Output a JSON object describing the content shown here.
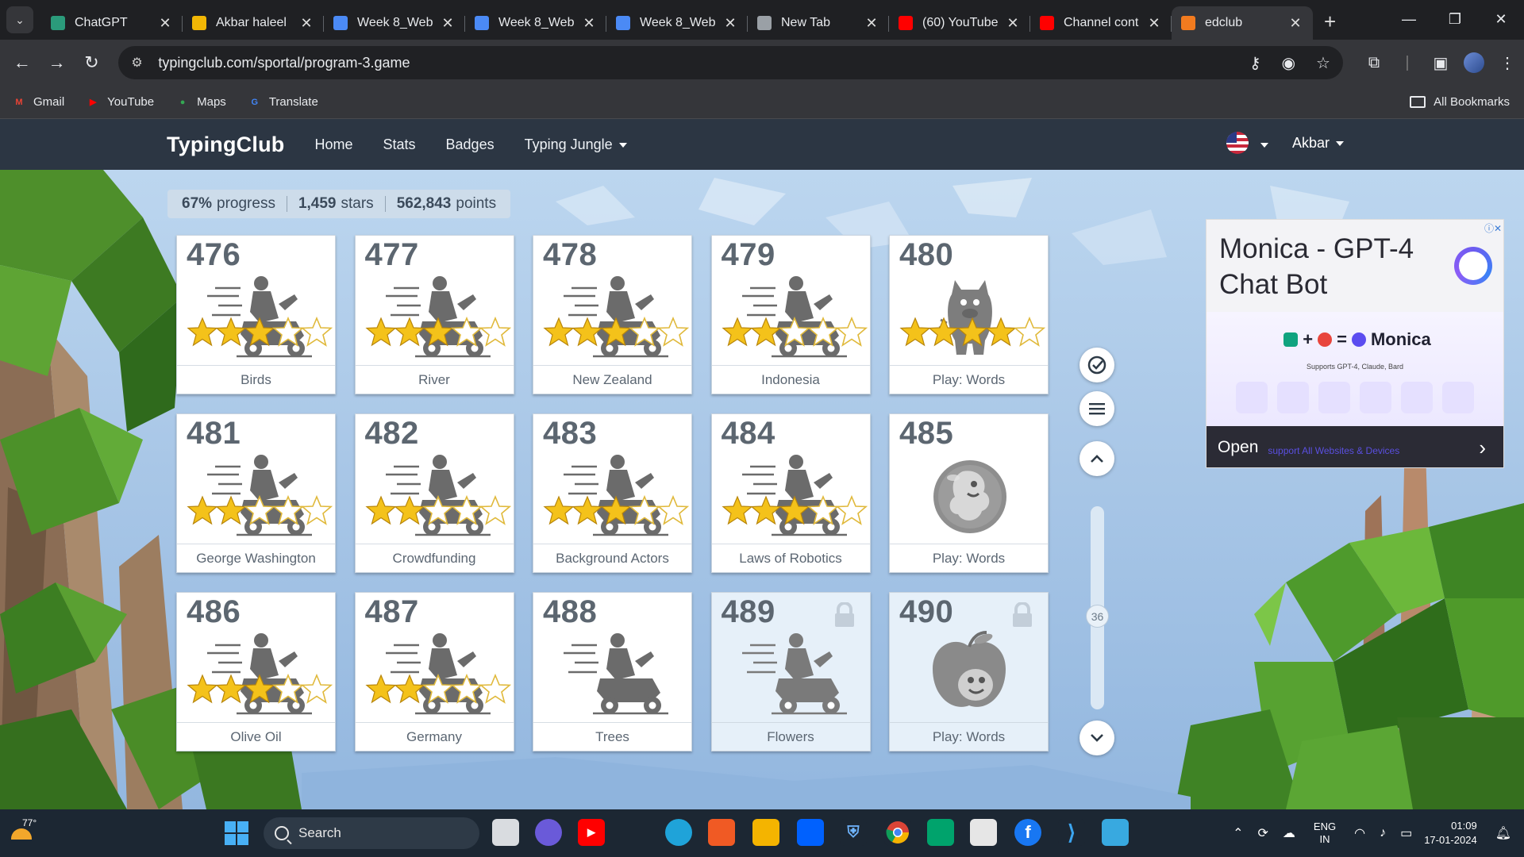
{
  "browser": {
    "tabs": [
      {
        "title": "ChatGPT",
        "favicon_color": "#2b9b7b"
      },
      {
        "title": "Akbar haleel",
        "favicon_color": "#f2b705"
      },
      {
        "title": "Week 8_Web",
        "favicon_color": "#4b8af5"
      },
      {
        "title": "Week 8_Web",
        "favicon_color": "#4b8af5"
      },
      {
        "title": "Week 8_Web",
        "favicon_color": "#4b8af5"
      },
      {
        "title": "New Tab",
        "favicon_color": "#9aa0a6"
      },
      {
        "title": "(60) YouTube",
        "favicon_color": "#ff0000"
      },
      {
        "title": "Channel cont",
        "favicon_color": "#ff0000"
      },
      {
        "title": "edclub",
        "favicon_color": "#f27b1f",
        "active": true
      }
    ],
    "url": "typingclub.com/sportal/program-3.game",
    "bookmarks": [
      {
        "label": "Gmail",
        "color": "#ea4335",
        "glyph": "M"
      },
      {
        "label": "YouTube",
        "color": "#ff0000",
        "glyph": "▶"
      },
      {
        "label": "Maps",
        "color": "#34a853",
        "glyph": "●"
      },
      {
        "label": "Translate",
        "color": "#4285f4",
        "glyph": "G"
      }
    ],
    "all_bookmarks_label": "All Bookmarks"
  },
  "site": {
    "brand": "TypingClub",
    "nav": [
      "Home",
      "Stats",
      "Badges",
      "Typing Jungle"
    ],
    "user": "Akbar"
  },
  "progress": {
    "percent": "67%",
    "percent_label": "progress",
    "stars": "1,459",
    "stars_label": "stars",
    "points": "562,843",
    "points_label": "points"
  },
  "lessons": [
    {
      "number": "476",
      "name": "Birds",
      "stars": 3,
      "type": "scooter",
      "locked": false
    },
    {
      "number": "477",
      "name": "River",
      "stars": 3,
      "type": "scooter",
      "locked": false
    },
    {
      "number": "478",
      "name": "New Zealand",
      "stars": 3,
      "type": "scooter",
      "locked": false
    },
    {
      "number": "479",
      "name": "Indonesia",
      "stars": 2,
      "type": "scooter",
      "locked": false
    },
    {
      "number": "480",
      "name": "Play: Words",
      "stars": 4,
      "type": "monster",
      "locked": false
    },
    {
      "number": "481",
      "name": "George Washington",
      "stars": 2,
      "type": "scooter",
      "locked": false
    },
    {
      "number": "482",
      "name": "Crowdfunding",
      "stars": 2,
      "type": "scooter",
      "locked": false
    },
    {
      "number": "483",
      "name": "Background Actors",
      "stars": 3,
      "type": "scooter",
      "locked": false
    },
    {
      "number": "484",
      "name": "Laws of Robotics",
      "stars": 3,
      "type": "scooter",
      "locked": false
    },
    {
      "number": "485",
      "name": "Play: Words",
      "stars": 0,
      "type": "bubble",
      "locked": false
    },
    {
      "number": "486",
      "name": "Olive Oil",
      "stars": 3,
      "type": "scooter",
      "locked": false
    },
    {
      "number": "487",
      "name": "Germany",
      "stars": 2,
      "type": "scooter",
      "locked": false
    },
    {
      "number": "488",
      "name": "Trees",
      "stars": 0,
      "type": "scooter",
      "locked": false
    },
    {
      "number": "489",
      "name": "Flowers",
      "stars": 0,
      "type": "scooter",
      "locked": true
    },
    {
      "number": "490",
      "name": "Play: Words",
      "stars": 0,
      "type": "apple",
      "locked": true
    }
  ],
  "scroll": {
    "page_indicator": "36"
  },
  "ad": {
    "title": "Monica - GPT-4 Chat Bot",
    "brand": "Monica",
    "supports": "Supports GPT-4, Claude, Bard",
    "cta": "Open",
    "sub": "support All Websites & Devices"
  },
  "taskbar": {
    "weather_temp": "77°",
    "search_label": "Search",
    "lang_line1": "ENG",
    "lang_line2": "IN",
    "time": "01:09",
    "date": "17-01-2024"
  },
  "colors": {
    "accent_nav": "#2c3643",
    "star_gold": "#f4c21a",
    "card_border": "#c9d4df"
  }
}
